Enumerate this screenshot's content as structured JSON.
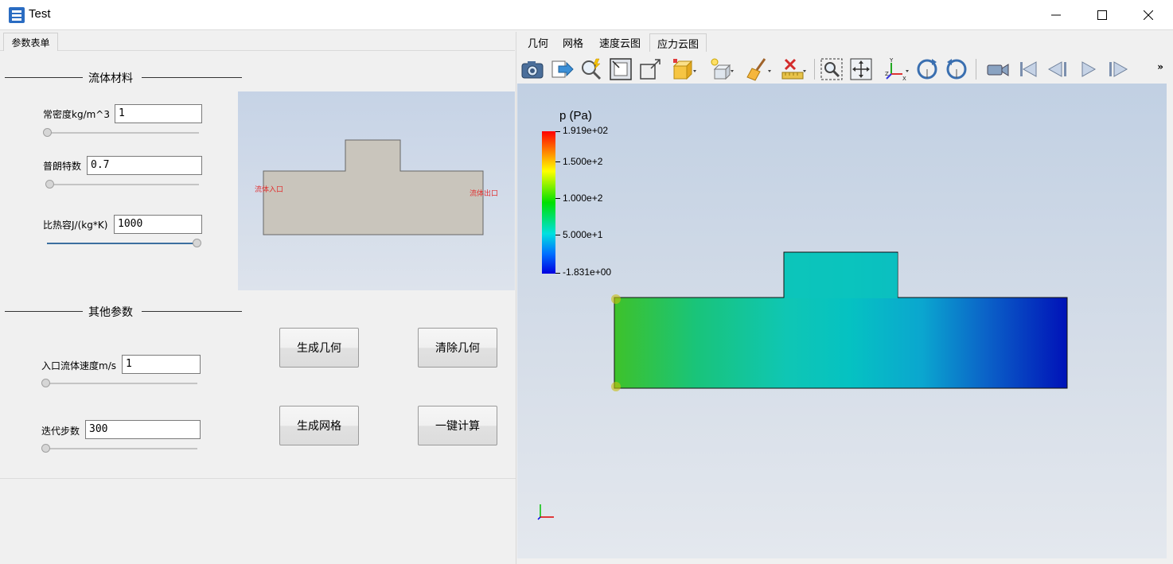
{
  "window": {
    "title": "Test"
  },
  "left_tab": {
    "label": "参数表单"
  },
  "fluid_group": {
    "title": "流体材料",
    "params": [
      {
        "label": "常密度kg/m^3",
        "value": "1"
      },
      {
        "label": "普朗特数",
        "value": "0.7"
      },
      {
        "label": "比热容J/(kg*K)",
        "value": "1000"
      }
    ]
  },
  "other_group": {
    "title": "其他参数",
    "params": [
      {
        "label": "入口流体速度m/s",
        "value": "1"
      },
      {
        "label": "迭代步数",
        "value": "300"
      }
    ]
  },
  "preview": {
    "inlet_label": "流体入口",
    "outlet_label": "流体出口",
    "fill_color": "#c9c5bc"
  },
  "buttons": {
    "gen_geometry": "生成几何",
    "clear_geometry": "清除几何",
    "gen_mesh": "生成网格",
    "compute": "一键计算"
  },
  "right_tabs": [
    {
      "label": "几何"
    },
    {
      "label": "网格"
    },
    {
      "label": "速度云图"
    },
    {
      "label": "应力云图",
      "active": true
    }
  ],
  "toolbar": {
    "icons": [
      "camera-icon",
      "export-icon",
      "pick-icon",
      "reset-camera-icon",
      "zoom-data-icon",
      "representation-icon",
      "lighting-icon",
      "clear-icon",
      "delete-icon",
      "ruler-icon",
      "zoom-box-icon",
      "fit-icon",
      "axes-icon",
      "rotate-cw-icon",
      "rotate-ccw-icon",
      "video-icon",
      "first-frame-icon",
      "prev-frame-icon",
      "play-icon",
      "next-frame-icon"
    ],
    "more": "»"
  },
  "legend": {
    "title": "p (Pa)",
    "labels": [
      "1.919e+02",
      "1.500e+2",
      "1.000e+2",
      "5.000e+1",
      "-1.831e+00"
    ],
    "colors": [
      "#ff0000",
      "#ffff00",
      "#00e000",
      "#00e0e0",
      "#0000e0"
    ]
  }
}
